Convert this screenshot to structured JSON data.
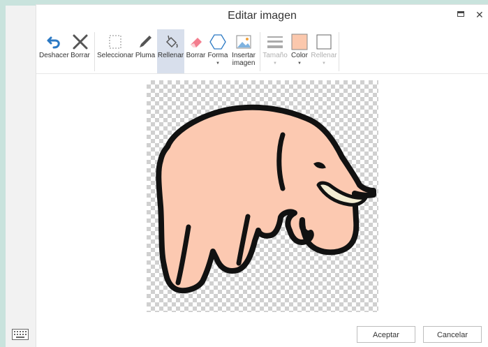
{
  "dialog": {
    "title": "Editar imagen"
  },
  "toolbar": {
    "undo": "Deshacer",
    "clear": "Borrar",
    "select": "Seleccionar",
    "pen": "Pluma",
    "fill": "Rellenar",
    "erase": "Borrar",
    "shape": "Forma",
    "insert_line1": "Insertar",
    "insert_line2": "imagen",
    "size": "Tamaño",
    "color": "Color",
    "fill_option": "Rellenar",
    "current_color": "#fbc8ad"
  },
  "buttons": {
    "ok": "Aceptar",
    "cancel": "Cancelar"
  },
  "image": {
    "body_color": "#fcc9b1",
    "tusk_color": "#f3edd3",
    "outline_color": "#111111"
  }
}
